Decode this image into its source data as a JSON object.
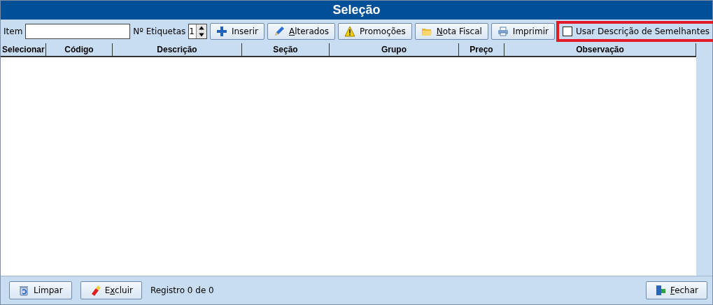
{
  "window": {
    "title": "Seleção"
  },
  "toolbar": {
    "item_label": "Item",
    "labels_count_label": "Nº Etiquetas",
    "labels_count": "1",
    "buttons": [
      {
        "kind": "insert",
        "pre": "Inserir"
      },
      {
        "kind": "changed",
        "accel": "A",
        "post": "lterados"
      },
      {
        "kind": "promo",
        "pre": "Promoções"
      },
      {
        "kind": "invoice",
        "accel": "N",
        "post": "ota Fiscal"
      },
      {
        "kind": "print",
        "pre": "Imprimir"
      }
    ],
    "similar_checkbox": {
      "label": "Usar Descrição de Semelhantes",
      "checked": false,
      "highlighted": true
    }
  },
  "table": {
    "columns": [
      "Selecionar",
      "Código",
      "Descrição",
      "Seção",
      "Grupo",
      "Preço",
      "Observação"
    ]
  },
  "footer": {
    "buttons": [
      {
        "kind": "clear",
        "pre": "Limpar"
      },
      {
        "kind": "delete",
        "pre": "E",
        "accel": "x",
        "post": "cluir"
      }
    ],
    "status": "Registro 0 de 0",
    "close_button": {
      "kind": "close",
      "accel": "F",
      "post": "echar"
    }
  }
}
